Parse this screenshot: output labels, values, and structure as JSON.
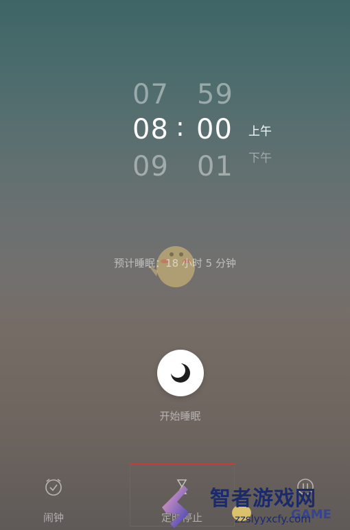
{
  "picker": {
    "hour_prev": "07",
    "hour_selected": "08",
    "hour_next": "09",
    "separator": ":",
    "minute_prev": "59",
    "minute_selected": "00",
    "minute_next": "01",
    "am_label": "上午",
    "pm_label": "下午"
  },
  "estimate_text": "预计睡眠：18 小时 5 分钟",
  "sleep_button": {
    "icon": "moon-icon",
    "label": "开始睡眠"
  },
  "nav": {
    "items": [
      {
        "label": "闹钟",
        "icon": "alarm-check-icon"
      },
      {
        "label": "定时停止",
        "icon": "hourglass-icon"
      },
      {
        "label": "",
        "icon": "pause-circle-icon"
      }
    ]
  },
  "watermark": {
    "title": "智者游戏网",
    "url": "zzslyyxcfy.com",
    "game": "GAME"
  },
  "colors": {
    "highlight_box": "#d23a3a",
    "watermark_blue": "#1a2a6b"
  }
}
